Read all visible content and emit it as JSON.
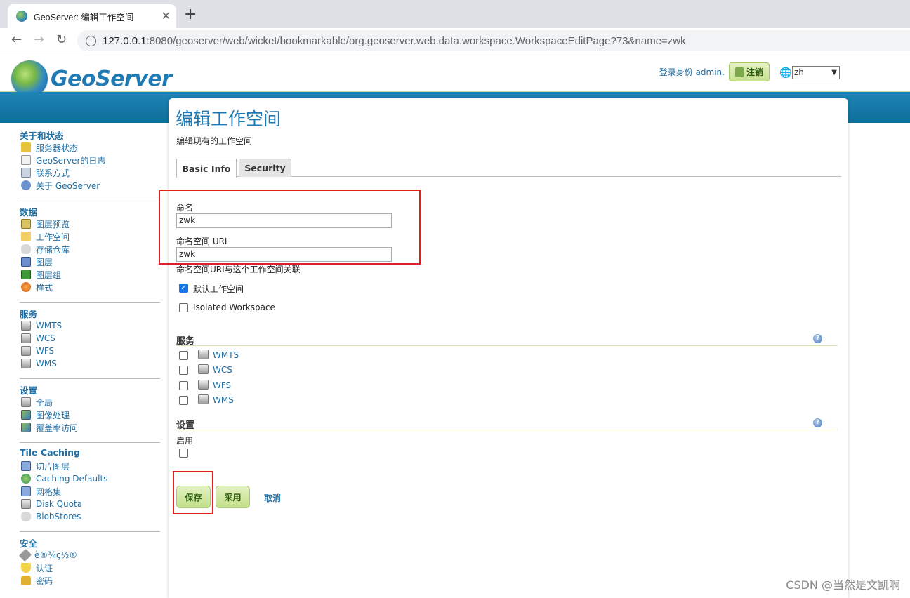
{
  "browser": {
    "tab_title": "GeoServer: 编辑工作空间",
    "tab_close": "✕",
    "new_tab": "+",
    "back": "←",
    "forward": "→",
    "reload": "↻",
    "url_host": "127.0.0.1",
    "url_rest": ":8080/geoserver/web/wicket/bookmarkable/org.geoserver.web.data.workspace.WorkspaceEditPage?73&name=zwk"
  },
  "header": {
    "logo_text": "GeoServer",
    "login_as": "登录身份 admin.",
    "logout": "注销",
    "language": "zh"
  },
  "sidebar": {
    "sections": [
      {
        "title": "关于和状态",
        "items": [
          "服务器状态",
          "GeoServer的日志",
          "联系方式",
          "关于 GeoServer"
        ]
      },
      {
        "title": "数据",
        "items": [
          "图层预览",
          "工作空间",
          "存储仓库",
          "图层",
          "图层组",
          "样式"
        ]
      },
      {
        "title": "服务",
        "items": [
          "WMTS",
          "WCS",
          "WFS",
          "WMS"
        ]
      },
      {
        "title": "设置",
        "items": [
          "全局",
          "图像处理",
          "覆盖率访问"
        ]
      },
      {
        "title": "Tile Caching",
        "items": [
          "切片图层",
          "Caching Defaults",
          "网格集",
          "Disk Quota",
          "BlobStores"
        ]
      },
      {
        "title": "安全",
        "items": [
          "è®¾ç½®",
          "认证",
          "密码"
        ]
      }
    ]
  },
  "main": {
    "title": "编辑工作空间",
    "description": "编辑现有的工作空间",
    "tabs": [
      "Basic Info",
      "Security"
    ],
    "name_label": "命名",
    "name_value": "zwk",
    "uri_label": "命名空间 URI",
    "uri_value": "zwk",
    "uri_hint": "命名空间URI与这个工作空间关联",
    "default_ws_label": "默认工作空间",
    "default_ws_checked": true,
    "isolated_label": "Isolated Workspace",
    "services_title": "服务",
    "services": [
      "WMTS",
      "WCS",
      "WFS",
      "WMS"
    ],
    "settings_title": "设置",
    "enable_label": "启用",
    "save": "保存",
    "apply": "采用",
    "cancel": "取消",
    "help": "?"
  },
  "watermark": "CSDN @当然是文凯啊",
  "colors": {
    "accent": "#1f7ab4",
    "band": "#1378a8",
    "highlight": "#e32020"
  }
}
